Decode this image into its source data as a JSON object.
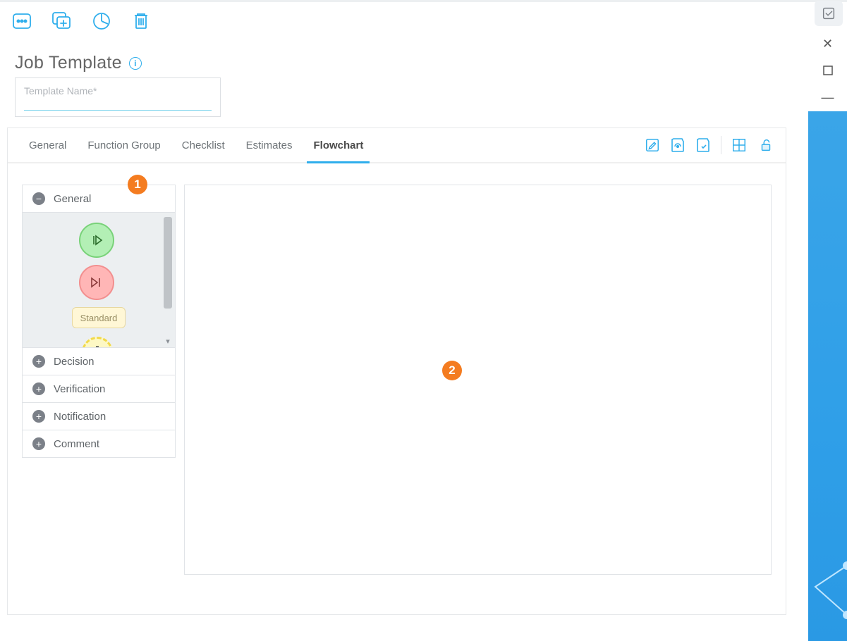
{
  "top_icons": {
    "more": "more-options",
    "copy_add": "duplicate-add",
    "report": "analysis",
    "delete": "delete"
  },
  "page_title": "Job Template",
  "template_name": {
    "value": "",
    "placeholder": "Template Name*"
  },
  "tabs": {
    "items": [
      "General",
      "Function Group",
      "Checklist",
      "Estimates",
      "Flowchart"
    ],
    "active_index": 4
  },
  "tab_action_icons": {
    "edit": "edit",
    "save": "save-template",
    "saveas": "save-as",
    "grid": "toggle-grid",
    "lock": "unlock"
  },
  "palette": {
    "sections": [
      {
        "label": "General",
        "expanded": true
      },
      {
        "label": "Decision",
        "expanded": false
      },
      {
        "label": "Verification",
        "expanded": false
      },
      {
        "label": "Notification",
        "expanded": false
      },
      {
        "label": "Comment",
        "expanded": false
      }
    ],
    "standard_label": "Standard"
  },
  "callouts": {
    "c1": "1",
    "c2": "2"
  },
  "right_pane": {
    "float": "pin-panel",
    "close": "✕",
    "maximize": "□",
    "minimize": "—"
  }
}
